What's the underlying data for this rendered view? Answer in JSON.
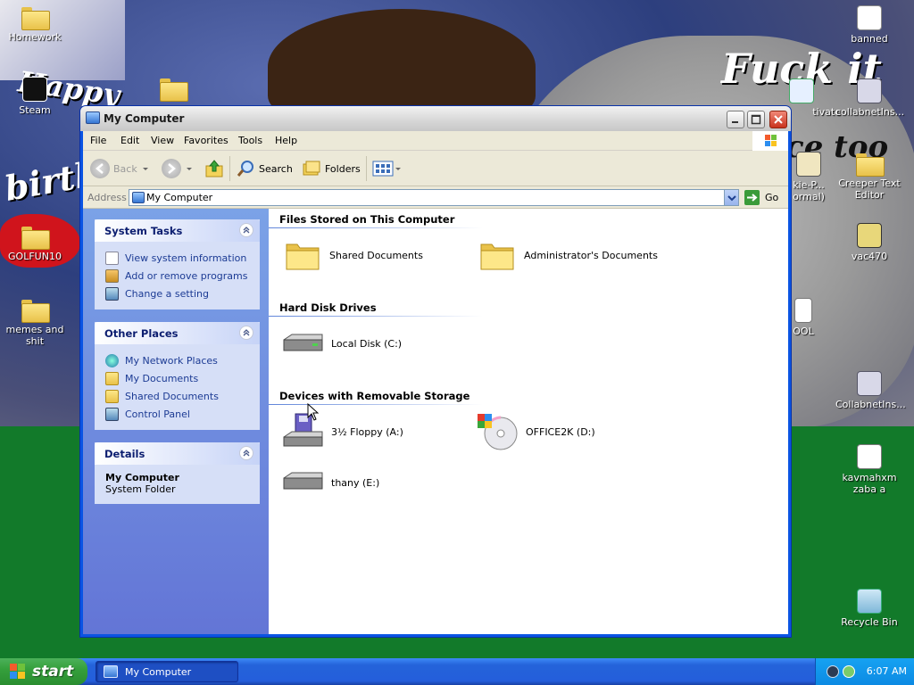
{
  "desktop": {
    "icons_left": [
      {
        "label": "Homework",
        "icon": "folder-icon"
      },
      {
        "label": "Steam",
        "icon": "steam-shortcut-icon"
      },
      {
        "label": "",
        "icon": "folder-icon"
      },
      {
        "label": "GOLFUN10",
        "icon": "folder-icon"
      },
      {
        "label": "memes and shit",
        "icon": "folder-icon"
      }
    ],
    "icons_right": [
      {
        "label": "banned",
        "icon": "document-icon"
      },
      {
        "label": "tivate",
        "icon": "setup-icon"
      },
      {
        "label": "collabnetIns...",
        "icon": "installer-icon"
      },
      {
        "label": "kie-P... ormal)",
        "icon": "program-icon"
      },
      {
        "label": "Creeper Text Editor",
        "icon": "folder-icon"
      },
      {
        "label": "vac470",
        "icon": "archive-7z-icon"
      },
      {
        "label": "OOL",
        "icon": "text-file-icon"
      },
      {
        "label": "CollabnetIns...",
        "icon": "installer-icon"
      },
      {
        "label": "kavmahxm zaba a",
        "icon": "media-file-icon"
      },
      {
        "label": "Recycle Bin",
        "icon": "recycle-bin-icon"
      }
    ],
    "wallpaper_text": [
      "Happy",
      "birth",
      "Fuck it",
      "ce too"
    ]
  },
  "window": {
    "title": "My Computer",
    "menu": [
      "File",
      "Edit",
      "View",
      "Favorites",
      "Tools",
      "Help"
    ],
    "toolbar": {
      "back": "Back",
      "search": "Search",
      "folders": "Folders"
    },
    "address": {
      "label": "Address",
      "value": "My Computer",
      "go": "Go"
    },
    "taskpane": {
      "system_tasks": {
        "title": "System Tasks",
        "items": [
          "View system information",
          "Add or remove programs",
          "Change a setting"
        ]
      },
      "other_places": {
        "title": "Other Places",
        "items": [
          "My Network Places",
          "My Documents",
          "Shared Documents",
          "Control Panel"
        ]
      },
      "details": {
        "title": "Details",
        "name": "My Computer",
        "type": "System Folder"
      }
    },
    "groups": {
      "files": {
        "title": "Files Stored on This Computer",
        "items": [
          "Shared Documents",
          "Administrator's Documents"
        ]
      },
      "hdd": {
        "title": "Hard Disk Drives",
        "items": [
          "Local Disk (C:)"
        ]
      },
      "removable": {
        "title": "Devices with Removable Storage",
        "items": [
          "3½ Floppy (A:)",
          "OFFICE2K (D:)",
          "thany (E:)"
        ]
      }
    }
  },
  "taskbar": {
    "start": "start",
    "task_button": "My Computer",
    "clock": "6:07 AM"
  },
  "colors": {
    "xp_blue": "#0a54e3",
    "taskpane": "#7ba2e7",
    "start_green": "#35a03c",
    "tray": "#0c8ae3"
  }
}
